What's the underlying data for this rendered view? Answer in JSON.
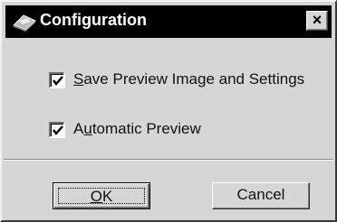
{
  "window": {
    "title": "Configuration",
    "close_glyph": "×",
    "icon": "app-icon"
  },
  "options": [
    {
      "mnemonic": "S",
      "rest": "ave Preview Image and Settings",
      "checked": true
    },
    {
      "pre": "A",
      "mnemonic": "u",
      "rest": "tomatic Preview",
      "checked": true
    }
  ],
  "buttons": {
    "ok_mnemonic": "O",
    "ok_rest": "K",
    "cancel": "Cancel"
  }
}
